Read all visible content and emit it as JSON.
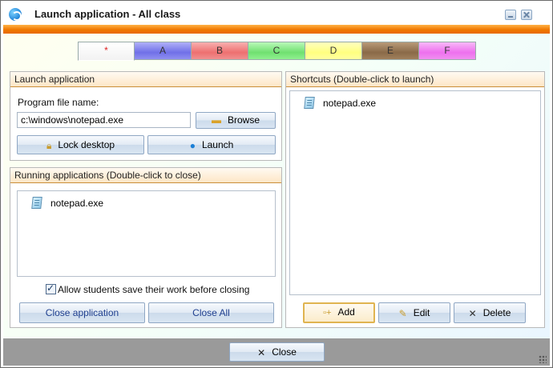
{
  "window": {
    "title": "Launch application - All class"
  },
  "tabs": [
    "*",
    "A",
    "B",
    "C",
    "D",
    "E",
    "F"
  ],
  "tab_colors": [
    "#ffffff",
    "#8c8cf0",
    "#f08c8c",
    "#8cf08c",
    "#ffff8c",
    "#9a7a55",
    "#f08cf0"
  ],
  "launch": {
    "header": "Launch application",
    "program_label": "Program file name:",
    "program_value": "c:\\windows\\notepad.exe",
    "browse_label": "Browse",
    "lock_label": "Lock desktop",
    "launch_label": "Launch"
  },
  "running": {
    "header": "Running applications (Double-click to close)",
    "items": [
      "notepad.exe"
    ],
    "allow_save_label": "Allow students save their work before closing",
    "allow_save_checked": true,
    "close_app_label": "Close application",
    "close_all_label": "Close All"
  },
  "shortcuts": {
    "header": "Shortcuts (Double-click to launch)",
    "items": [
      "notepad.exe"
    ],
    "add_label": "Add",
    "edit_label": "Edit",
    "delete_label": "Delete"
  },
  "footer": {
    "close_label": "Close"
  },
  "icons": {
    "app": "app-logo-icon",
    "browse": "folder-icon",
    "lock": "lock-icon",
    "launch": "launch-icon",
    "file": "file-icon",
    "add": "add-icon",
    "edit": "edit-icon",
    "delete": "delete-x-icon",
    "close": "close-x-icon"
  }
}
